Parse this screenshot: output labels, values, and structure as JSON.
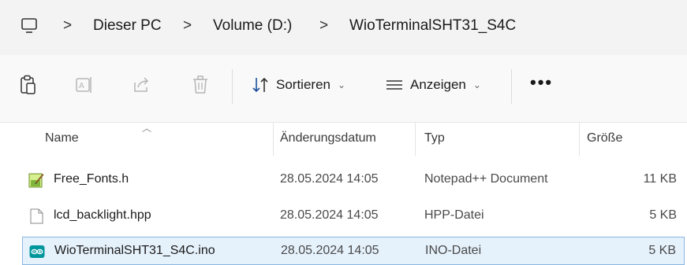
{
  "breadcrumb": {
    "separator": ">",
    "items": [
      "Dieser PC",
      "Volume (D:)",
      "WioTerminalSHT31_S4C"
    ]
  },
  "toolbar": {
    "sort_label": "Sortieren",
    "view_label": "Anzeigen",
    "dropdown_chevron": "⌄",
    "more_label": "•••"
  },
  "columns": {
    "name": "Name",
    "date": "Änderungsdatum",
    "type": "Typ",
    "size": "Größe"
  },
  "files": [
    {
      "name": "Free_Fonts.h",
      "date": "28.05.2024 14:05",
      "type": "Notepad++ Document",
      "size": "11 KB",
      "icon": "notepadpp-icon"
    },
    {
      "name": "lcd_backlight.hpp",
      "date": "28.05.2024 14:05",
      "type": "HPP-Datei",
      "size": "5 KB",
      "icon": "generic-file-icon"
    },
    {
      "name": "WioTerminalSHT31_S4C.ino",
      "date": "28.05.2024 14:05",
      "type": "INO-Datei",
      "size": "5 KB",
      "icon": "arduino-icon"
    }
  ],
  "colors": {
    "selection_bg": "#e5f1fb",
    "selection_border": "#89b5e0",
    "arduino": "#00979c"
  }
}
